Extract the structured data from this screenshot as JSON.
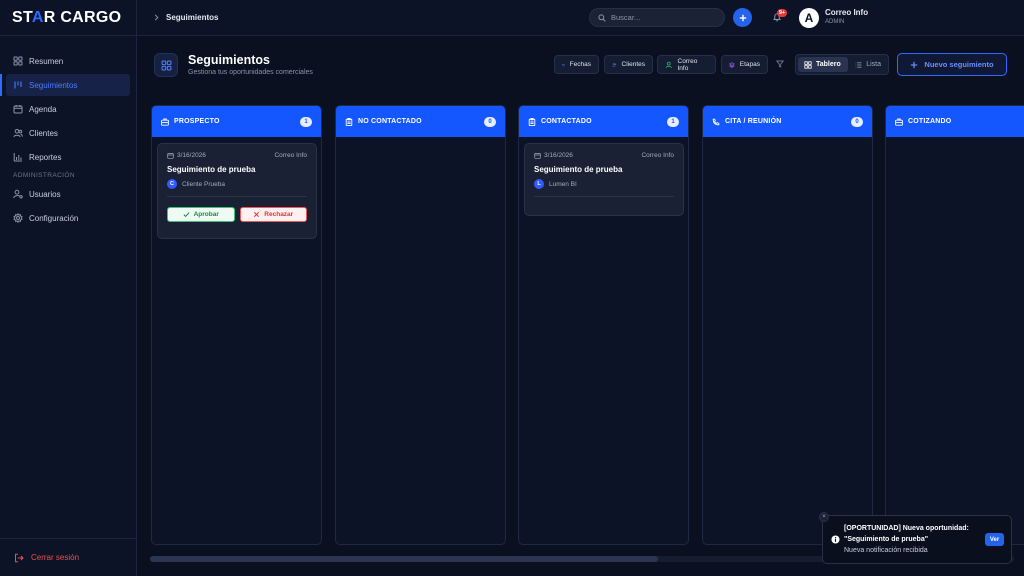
{
  "brand": {
    "part1": "ST",
    "star": "A",
    "part2": "R CARGO"
  },
  "sidebar": {
    "items": [
      {
        "label": "Resumen",
        "icon": "grid-icon"
      },
      {
        "label": "Seguimientos",
        "icon": "kanban-icon"
      },
      {
        "label": "Agenda",
        "icon": "calendar-icon"
      },
      {
        "label": "Clientes",
        "icon": "users-icon"
      },
      {
        "label": "Reportes",
        "icon": "bar-chart-icon"
      }
    ],
    "section_label": "ADMINISTRACIÓN",
    "admin_items": [
      {
        "label": "Usuarios",
        "icon": "user-settings-icon"
      },
      {
        "label": "Configuración",
        "icon": "gear-icon"
      }
    ],
    "logout_label": "Cerrar sesión"
  },
  "topbar": {
    "breadcrumb": "Seguimientos",
    "search_placeholder": "Buscar...",
    "notification_count": "9+",
    "avatar_letter": "A",
    "user_name": "Correo Info",
    "user_role": "ADMIN"
  },
  "header": {
    "title": "Seguimientos",
    "subtitle": "Gestiona tus oportunidades comerciales",
    "filters": {
      "fechas": "Fechas",
      "clientes": "Clientes",
      "correo": "Correo Info",
      "etapas": "Etapas"
    },
    "view_board": "Tablero",
    "view_list": "Lista",
    "new_button": "Nuevo seguimiento"
  },
  "columns": [
    {
      "title": "PROSPECTO",
      "count": "1"
    },
    {
      "title": "NO CONTACTADO",
      "count": "0"
    },
    {
      "title": "CONTACTADO",
      "count": "1"
    },
    {
      "title": "CITA / REUNIÓN",
      "count": "0"
    },
    {
      "title": "COTIZANDO"
    }
  ],
  "cards": {
    "prospecto": {
      "date": "3/16/2026",
      "owner": "Correo Info",
      "title": "Seguimiento de prueba",
      "client_initial": "C",
      "client": "Cliente Prueba",
      "approve": "Aprobar",
      "reject": "Rechazar"
    },
    "contactado": {
      "date": "3/16/2026",
      "owner": "Correo Info",
      "title": "Seguimiento de prueba",
      "client_initial": "L",
      "client": "Lumen BI"
    }
  },
  "toast": {
    "close": "×",
    "line1": "[OPORTUNIDAD] Nueva oportunidad:",
    "line2": "\"Seguimiento de prueba\"",
    "line3": "Nueva notificación recibida",
    "button": "Ver"
  },
  "colors": {
    "accent": "#1457ff",
    "danger": "#ef4f4f",
    "success": "#3ac27a",
    "background": "#0b1020"
  }
}
